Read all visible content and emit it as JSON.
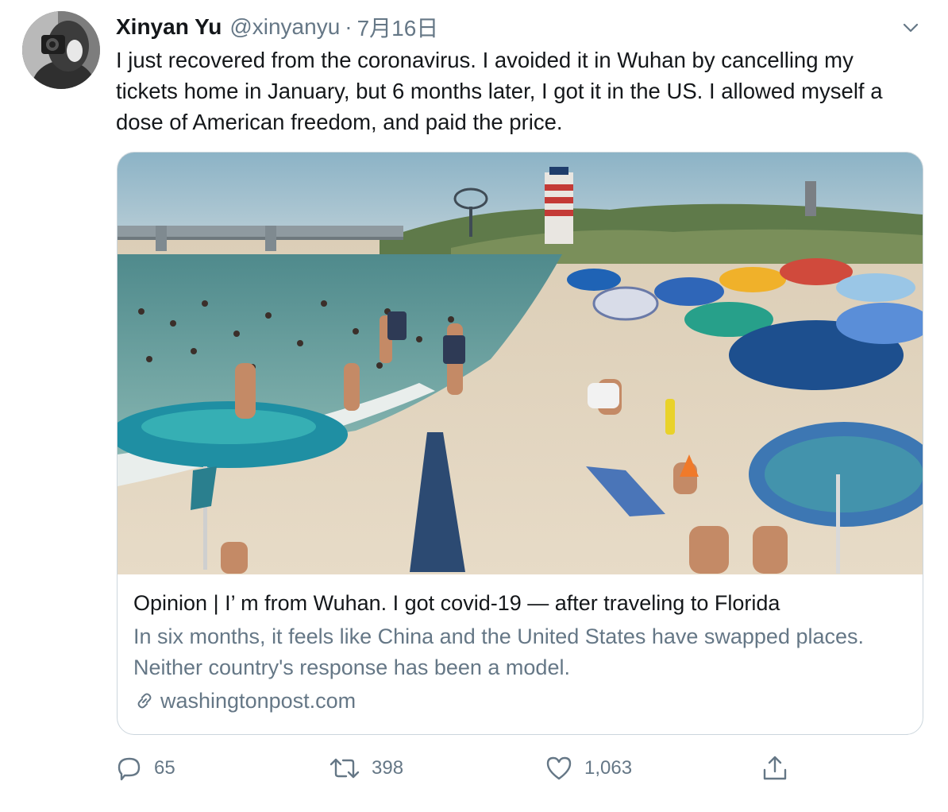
{
  "tweet": {
    "author_name": "Xinyan Yu",
    "author_handle": "@xinyanyu",
    "separator": "·",
    "date": "7月16日",
    "text": "I just recovered from the coronavirus. I avoided it in Wuhan by cancelling my tickets home in January, but 6 months later, I got it in the US. I allowed myself a dose of American freedom, and paid the price."
  },
  "card": {
    "title": "Opinion | I’ m from Wuhan. I got covid-19 — after traveling to Florida",
    "description": "In six months, it feels like China and the United States have swapped places. Neither country's response has been a model.",
    "domain": "washingtonpost.com"
  },
  "actions": {
    "reply_count": "65",
    "retweet_count": "398",
    "like_count": "1,063"
  },
  "icons": {
    "menu": "chevron-down-icon",
    "link": "link-icon",
    "reply": "reply-icon",
    "retweet": "retweet-icon",
    "like": "heart-icon",
    "share": "share-icon"
  },
  "colors": {
    "text_primary": "#14171a",
    "text_secondary": "#657786",
    "border": "#ccd6dd"
  }
}
